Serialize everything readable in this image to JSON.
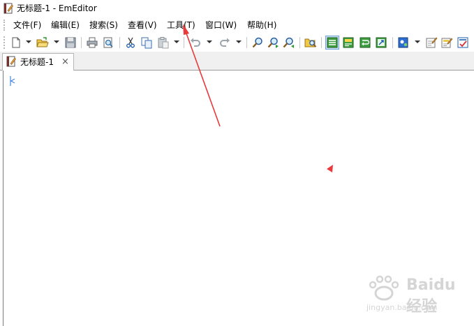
{
  "window": {
    "title": "无标题-1 - EmEditor"
  },
  "menu": {
    "items": [
      {
        "label": "文件(F)"
      },
      {
        "label": "编辑(E)"
      },
      {
        "label": "搜索(S)"
      },
      {
        "label": "查看(V)"
      },
      {
        "label": "工具(T)"
      },
      {
        "label": "窗口(W)"
      },
      {
        "label": "帮助(H)"
      }
    ]
  },
  "toolbar": {
    "icons": [
      "new-document-icon",
      "open-folder-icon",
      "save-icon",
      "print-icon",
      "print-preview-icon",
      "cut-icon",
      "copy-icon",
      "paste-icon",
      "undo-icon",
      "redo-icon",
      "find-icon",
      "find-next-icon",
      "find-previous-icon",
      "find-in-files-icon",
      "word-wrap-icon",
      "wrap-by-window-icon",
      "wrap-by-page-icon",
      "wrap-by-chars-icon",
      "macro-icon",
      "properties-icon",
      "customize-icon",
      "markers-icon"
    ]
  },
  "tabs": [
    {
      "label": "无标题-1",
      "close": "×"
    }
  ],
  "editor": {
    "content": ""
  },
  "watermark": {
    "text": "Baidu经验",
    "sub": "jingyan.baidu.com"
  },
  "colors": {
    "annotation": "#e8393b",
    "accent": "#1e6fd8"
  }
}
